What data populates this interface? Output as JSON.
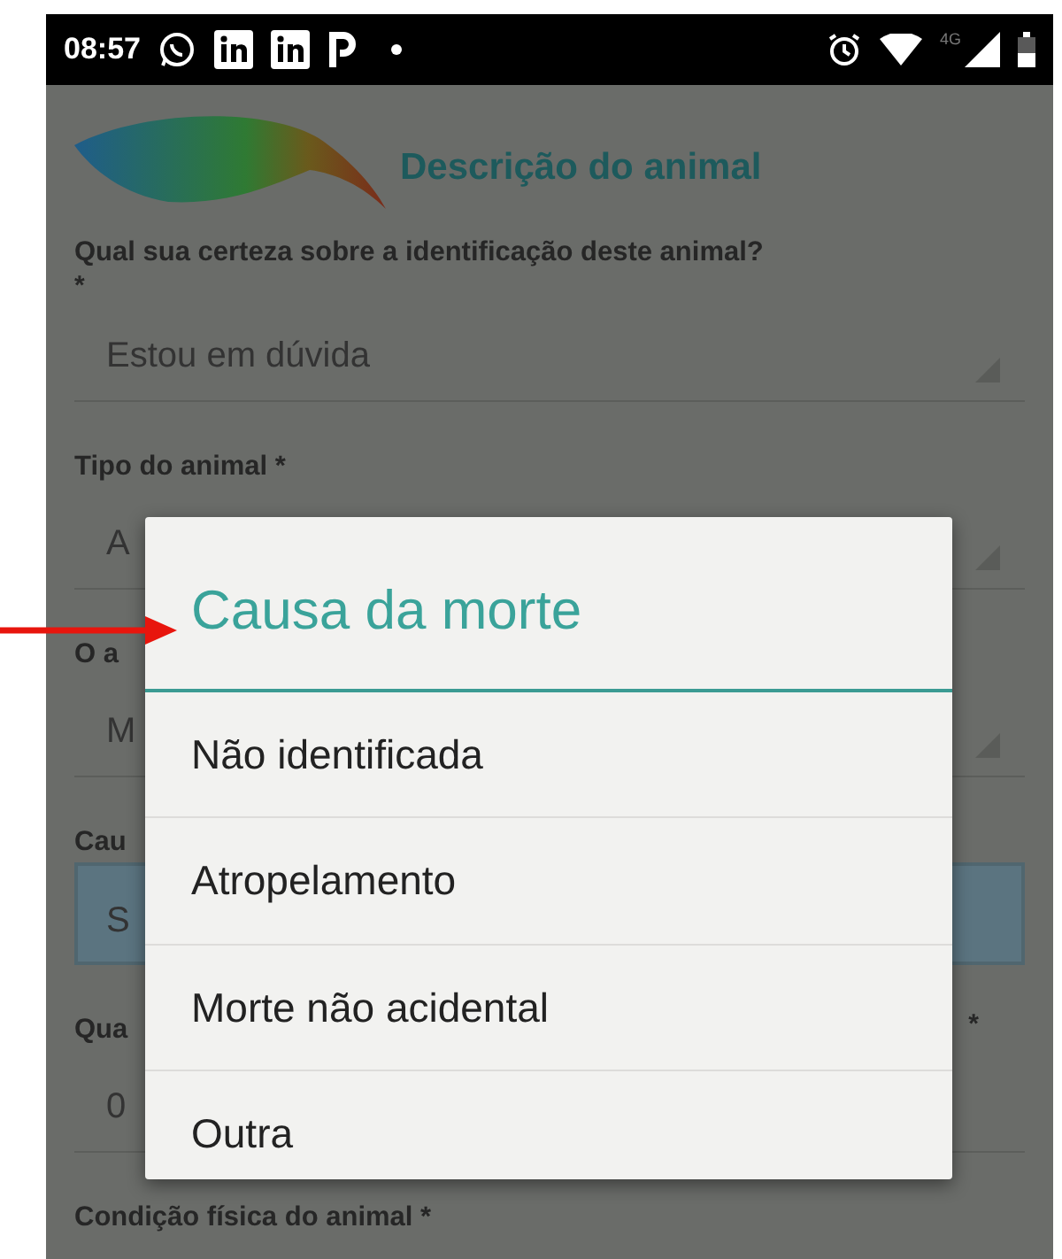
{
  "status_bar": {
    "time": "08:57",
    "network": "4G"
  },
  "header": {
    "title": "Descrição do animal"
  },
  "fields": [
    {
      "label": "Qual sua certeza sobre a identificação deste animal?",
      "required_mark": "*",
      "value": "Estou em dúvida",
      "kind": "select",
      "focused": false
    },
    {
      "label": "Tipo do animal *",
      "value": "A",
      "kind": "select",
      "focused": false
    },
    {
      "label": "O a",
      "value": "M",
      "kind": "select",
      "focused": false
    },
    {
      "label": "Cau",
      "value": "S",
      "kind": "select",
      "focused": true
    },
    {
      "label": "Qua",
      "side_mark": "*",
      "value": "0",
      "kind": "text",
      "focused": false
    },
    {
      "label": "Condição física do animal *"
    }
  ],
  "dialog": {
    "title": "Causa da morte",
    "options": [
      "Não identificada",
      "Atropelamento",
      "Morte não acidental",
      "Outra"
    ]
  }
}
